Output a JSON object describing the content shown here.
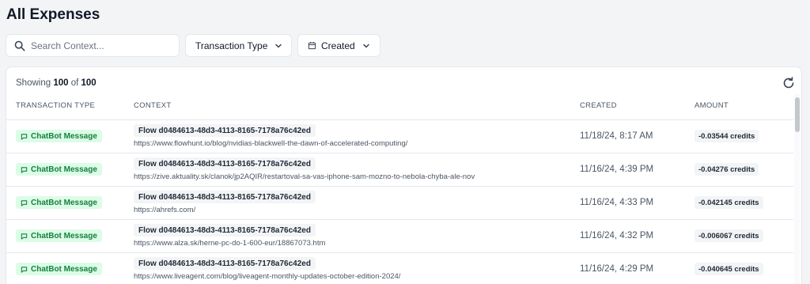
{
  "page": {
    "title": "All Expenses"
  },
  "filters": {
    "search_placeholder": "Search Context...",
    "transaction_type_label": "Transaction Type",
    "created_label": "Created"
  },
  "table": {
    "showing_prefix": "Showing",
    "showing_count": "100",
    "showing_of": "of",
    "showing_total": "100",
    "columns": [
      "TRANSACTION TYPE",
      "CONTEXT",
      "CREATED",
      "AMOUNT"
    ],
    "rows": [
      {
        "type": "ChatBot Message",
        "flow": "Flow d0484613-48d3-4113-8165-7178a76c42ed",
        "url": "https://www.flowhunt.io/blog/nvidias-blackwell-the-dawn-of-accelerated-computing/",
        "created": "11/18/24, 8:17 AM",
        "amount": "-0.03544 credits"
      },
      {
        "type": "ChatBot Message",
        "flow": "Flow d0484613-48d3-4113-8165-7178a76c42ed",
        "url": "https://zive.aktuality.sk/clanok/jp2AQIR/restartoval-sa-vas-iphone-sam-mozno-to-nebola-chyba-ale-nov",
        "created": "11/16/24, 4:39 PM",
        "amount": "-0.04276 credits"
      },
      {
        "type": "ChatBot Message",
        "flow": "Flow d0484613-48d3-4113-8165-7178a76c42ed",
        "url": "https://ahrefs.com/",
        "created": "11/16/24, 4:33 PM",
        "amount": "-0.042145 credits"
      },
      {
        "type": "ChatBot Message",
        "flow": "Flow d0484613-48d3-4113-8165-7178a76c42ed",
        "url": "https://www.alza.sk/herne-pc-do-1-600-eur/18867073.htm",
        "created": "11/16/24, 4:32 PM",
        "amount": "-0.006067 credits"
      },
      {
        "type": "ChatBot Message",
        "flow": "Flow d0484613-48d3-4113-8165-7178a76c42ed",
        "url": "https://www.liveagent.com/blog/liveagent-monthly-updates-october-edition-2024/",
        "created": "11/16/24, 4:29 PM",
        "amount": "-0.040645 credits"
      }
    ]
  },
  "icons": {
    "search": "search-icon",
    "chevron": "chevron-down-icon",
    "calendar": "calendar-icon",
    "refresh": "refresh-icon",
    "chat": "chat-bubble-icon"
  },
  "colors": {
    "badge_bg": "#dcfce7",
    "badge_text": "#15803d",
    "background": "#f3f4f6"
  }
}
